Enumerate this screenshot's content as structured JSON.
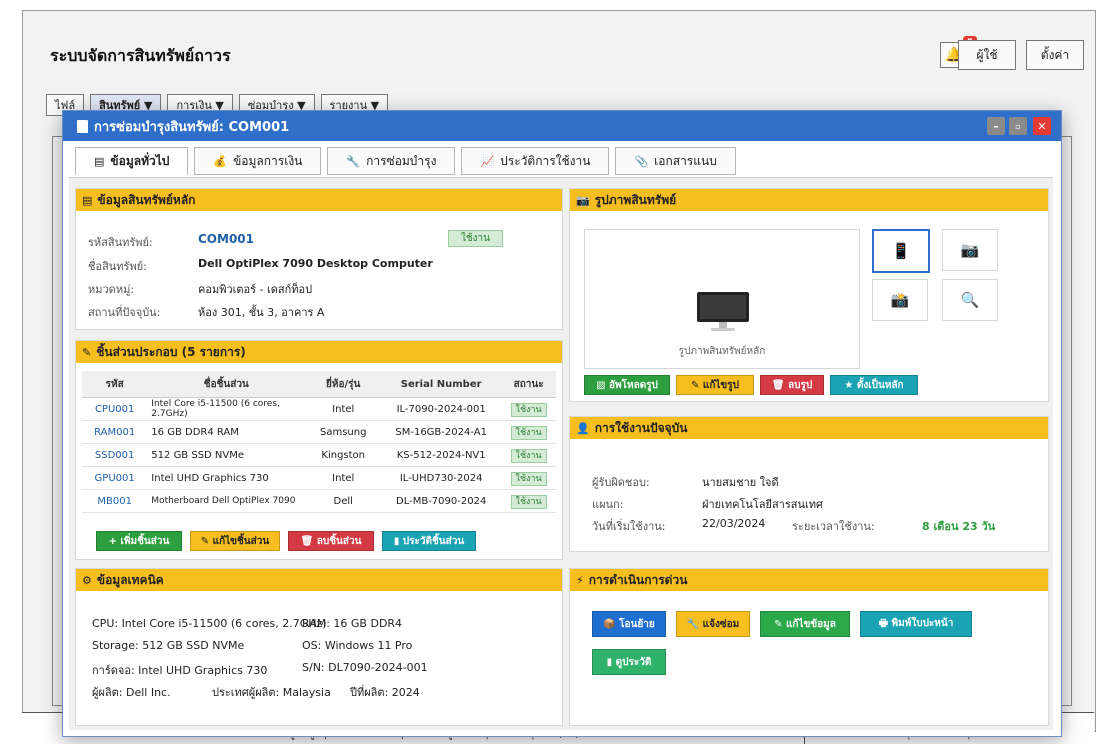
{
  "app": {
    "title": "ระบบจัดการสินทรัพย์ถาวร",
    "notification_count": "5",
    "user_btn": "ผู้ใช้",
    "settings_btn": "ตั้งค่า",
    "menus": [
      "ไฟล์",
      "สินทรัพย์ ▼",
      "การเงิน ▼",
      "ซ่อมบำรุง ▼",
      "รายงาน ▼"
    ]
  },
  "statusbar": {
    "left": "สถานะ: ดูข้อมูล | รหัส: COM001 | แท็บ: ข้อมูลทั่วไป | แก้ไขล่าสุด: 14/06/68",
    "right": "วันที่: 14 มิถุนายน 2568 | เวลา: 16:30:45"
  },
  "modal": {
    "title": "การซ่อมบำรุงสินทรัพย์: COM001",
    "tabs": [
      {
        "icon": "▤",
        "label": "ข้อมูลทั่วไป"
      },
      {
        "icon": "💰",
        "label": "ข้อมูลการเงิน"
      },
      {
        "icon": "🔧",
        "label": "การซ่อมบำรุง"
      },
      {
        "icon": "📈",
        "label": "ประวัติการใช้งาน"
      },
      {
        "icon": "📎",
        "label": "เอกสารแนบ"
      }
    ]
  },
  "main_info": {
    "heading": "ข้อมูลสินทรัพย์หลัก",
    "code_label": "รหัสสินทรัพย์:",
    "code": "COM001",
    "status": "ใช้งาน",
    "name_label": "ชื่อสินทรัพย์:",
    "name": "Dell OptiPlex 7090 Desktop Computer",
    "category_label": "หมวดหมู่:",
    "category": "คอมพิวเตอร์ - เดสก์ท็อป",
    "location_label": "สถานที่ปัจจุบัน:",
    "location": "ห้อง 301, ชั้น 3, อาคาร A"
  },
  "components": {
    "heading": "ชิ้นส่วนประกอบ (5 รายการ)",
    "columns": [
      "รหัส",
      "ชื่อชิ้นส่วน",
      "ยี่ห้อ/รุ่น",
      "Serial Number",
      "สถานะ"
    ],
    "rows": [
      {
        "code": "CPU001",
        "name": "Intel Core i5-11500 (6 cores, 2.7GHz)",
        "brand": "Intel",
        "serial": "IL-7090-2024-001",
        "status": "ใช้งาน"
      },
      {
        "code": "RAM001",
        "name": "16 GB DDR4 RAM",
        "brand": "Samsung",
        "serial": "SM-16GB-2024-A1",
        "status": "ใช้งาน"
      },
      {
        "code": "SSD001",
        "name": "512 GB SSD NVMe",
        "brand": "Kingston",
        "serial": "KS-512-2024-NV1",
        "status": "ใช้งาน"
      },
      {
        "code": "GPU001",
        "name": "Intel UHD Graphics 730",
        "brand": "Intel",
        "serial": "IL-UHD730-2024",
        "status": "ใช้งาน"
      },
      {
        "code": "MB001",
        "name": "Motherboard Dell OptiPlex 7090",
        "brand": "Dell",
        "serial": "DL-MB-7090-2024",
        "status": "ใช้งาน"
      }
    ],
    "buttons": {
      "add": "+ เพิ่มชิ้นส่วน",
      "edit": "✎ แก้ไขชิ้นส่วน",
      "delete": "🗑 ลบชิ้นส่วน",
      "history": "▮ ประวัติชิ้นส่วน"
    }
  },
  "tech": {
    "heading": "ข้อมูลเทคนิค",
    "cpu": "CPU: Intel Core i5-11500 (6 cores, 2.7GHz)",
    "ram": "RAM: 16 GB DDR4",
    "storage": "Storage: 512 GB SSD NVMe",
    "os": "OS: Windows 11 Pro",
    "gpu": "การ์ดจอ: Intel UHD Graphics 730",
    "sn": "S/N: DL7090-2024-001",
    "maker": "ผู้ผลิต: Dell Inc.",
    "country": "ประเทศผู้ผลิต: Malaysia",
    "year": "ปีที่ผลิต: 2024"
  },
  "images": {
    "heading": "รูปภาพสินทรัพย์",
    "caption": "รูปภาพสินทรัพย์หลัก",
    "buttons": {
      "upload": "▨ อัพโหลดรูป",
      "edit": "✎ แก้ไขรูป",
      "delete": "🗑 ลบรูป",
      "primary": "★ ตั้งเป็นหลัก"
    }
  },
  "usage": {
    "heading": "การใช้งานปัจจุบัน",
    "owner_label": "ผู้รับผิดชอบ:",
    "owner": "นายสมชาย ใจดี",
    "dept_label": "แผนก:",
    "dept": "ฝ่ายเทคโนโลยีสารสนเทศ",
    "start_label": "วันที่เริ่มใช้งาน:",
    "start": "22/03/2024",
    "duration_label": "ระยะเวลาใช้งาน:",
    "duration": "8 เดือน 23 วัน",
    "accent": "#2e9f3e"
  },
  "quick": {
    "heading": "การดำเนินการด่วน",
    "buttons": {
      "move": "📦 โอนย้าย",
      "repair": "🔧 แจ้งซ่อม",
      "edit": "✎ แก้ไขข้อมูล",
      "print": "🖶 พิมพ์ใบปะหน้า",
      "history": "▮ ดูประวัติ"
    }
  }
}
